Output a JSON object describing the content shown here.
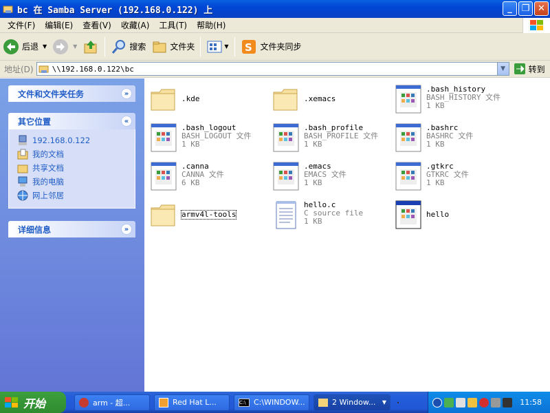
{
  "window": {
    "title": "bc 在 Samba Server (192.168.0.122) 上"
  },
  "menu": [
    "文件(F)",
    "编辑(E)",
    "查看(V)",
    "收藏(A)",
    "工具(T)",
    "帮助(H)"
  ],
  "toolbar": {
    "back": "后退",
    "search": "搜索",
    "folders": "文件夹",
    "sync": "文件夹同步"
  },
  "address": {
    "label": "地址(D)",
    "value": "\\\\192.168.0.122\\bc",
    "go": "转到"
  },
  "tasks": {
    "panel1": "文件和文件夹任务",
    "panel2": "其它位置",
    "places": [
      "192.168.0.122",
      "我的文档",
      "共享文档",
      "我的电脑",
      "网上邻居"
    ],
    "panel3": "详细信息"
  },
  "files": [
    {
      "name": ".kde",
      "type": "",
      "size": "",
      "icon": "folder"
    },
    {
      "name": ".xemacs",
      "type": "",
      "size": "",
      "icon": "folder"
    },
    {
      "name": ".bash_history",
      "type": "BASH_HISTORY 文件",
      "size": "1 KB",
      "icon": "generic-file"
    },
    {
      "name": ".bash_logout",
      "type": "BASH_LOGOUT 文件",
      "size": "1 KB",
      "icon": "generic-file"
    },
    {
      "name": ".bash_profile",
      "type": "BASH_PROFILE 文件",
      "size": "1 KB",
      "icon": "generic-file"
    },
    {
      "name": ".bashrc",
      "type": "BASHRC 文件",
      "size": "1 KB",
      "icon": "generic-file"
    },
    {
      "name": ".canna",
      "type": "CANNA 文件",
      "size": "6 KB",
      "icon": "generic-file"
    },
    {
      "name": ".emacs",
      "type": "EMACS 文件",
      "size": "1 KB",
      "icon": "generic-file"
    },
    {
      "name": ".gtkrc",
      "type": "GTKRC 文件",
      "size": "1 KB",
      "icon": "generic-file"
    },
    {
      "name": "armv4l-tools",
      "type": "",
      "size": "",
      "icon": "folder"
    },
    {
      "name": "hello.c",
      "type": "C source file",
      "size": "1 KB",
      "icon": "notepad-file"
    },
    {
      "name": "hello",
      "type": "",
      "size": "",
      "icon": "app-window"
    }
  ],
  "taskbar": {
    "start": "开始",
    "tasks": [
      "arm - 超...",
      "Red Hat L...",
      "C:\\WINDOW...",
      "2 Window..."
    ],
    "clock": "11:58"
  },
  "colors": {
    "title": "#0a5fe0",
    "taskpane": "#7ba2e7",
    "start": "#3c9f3c"
  }
}
